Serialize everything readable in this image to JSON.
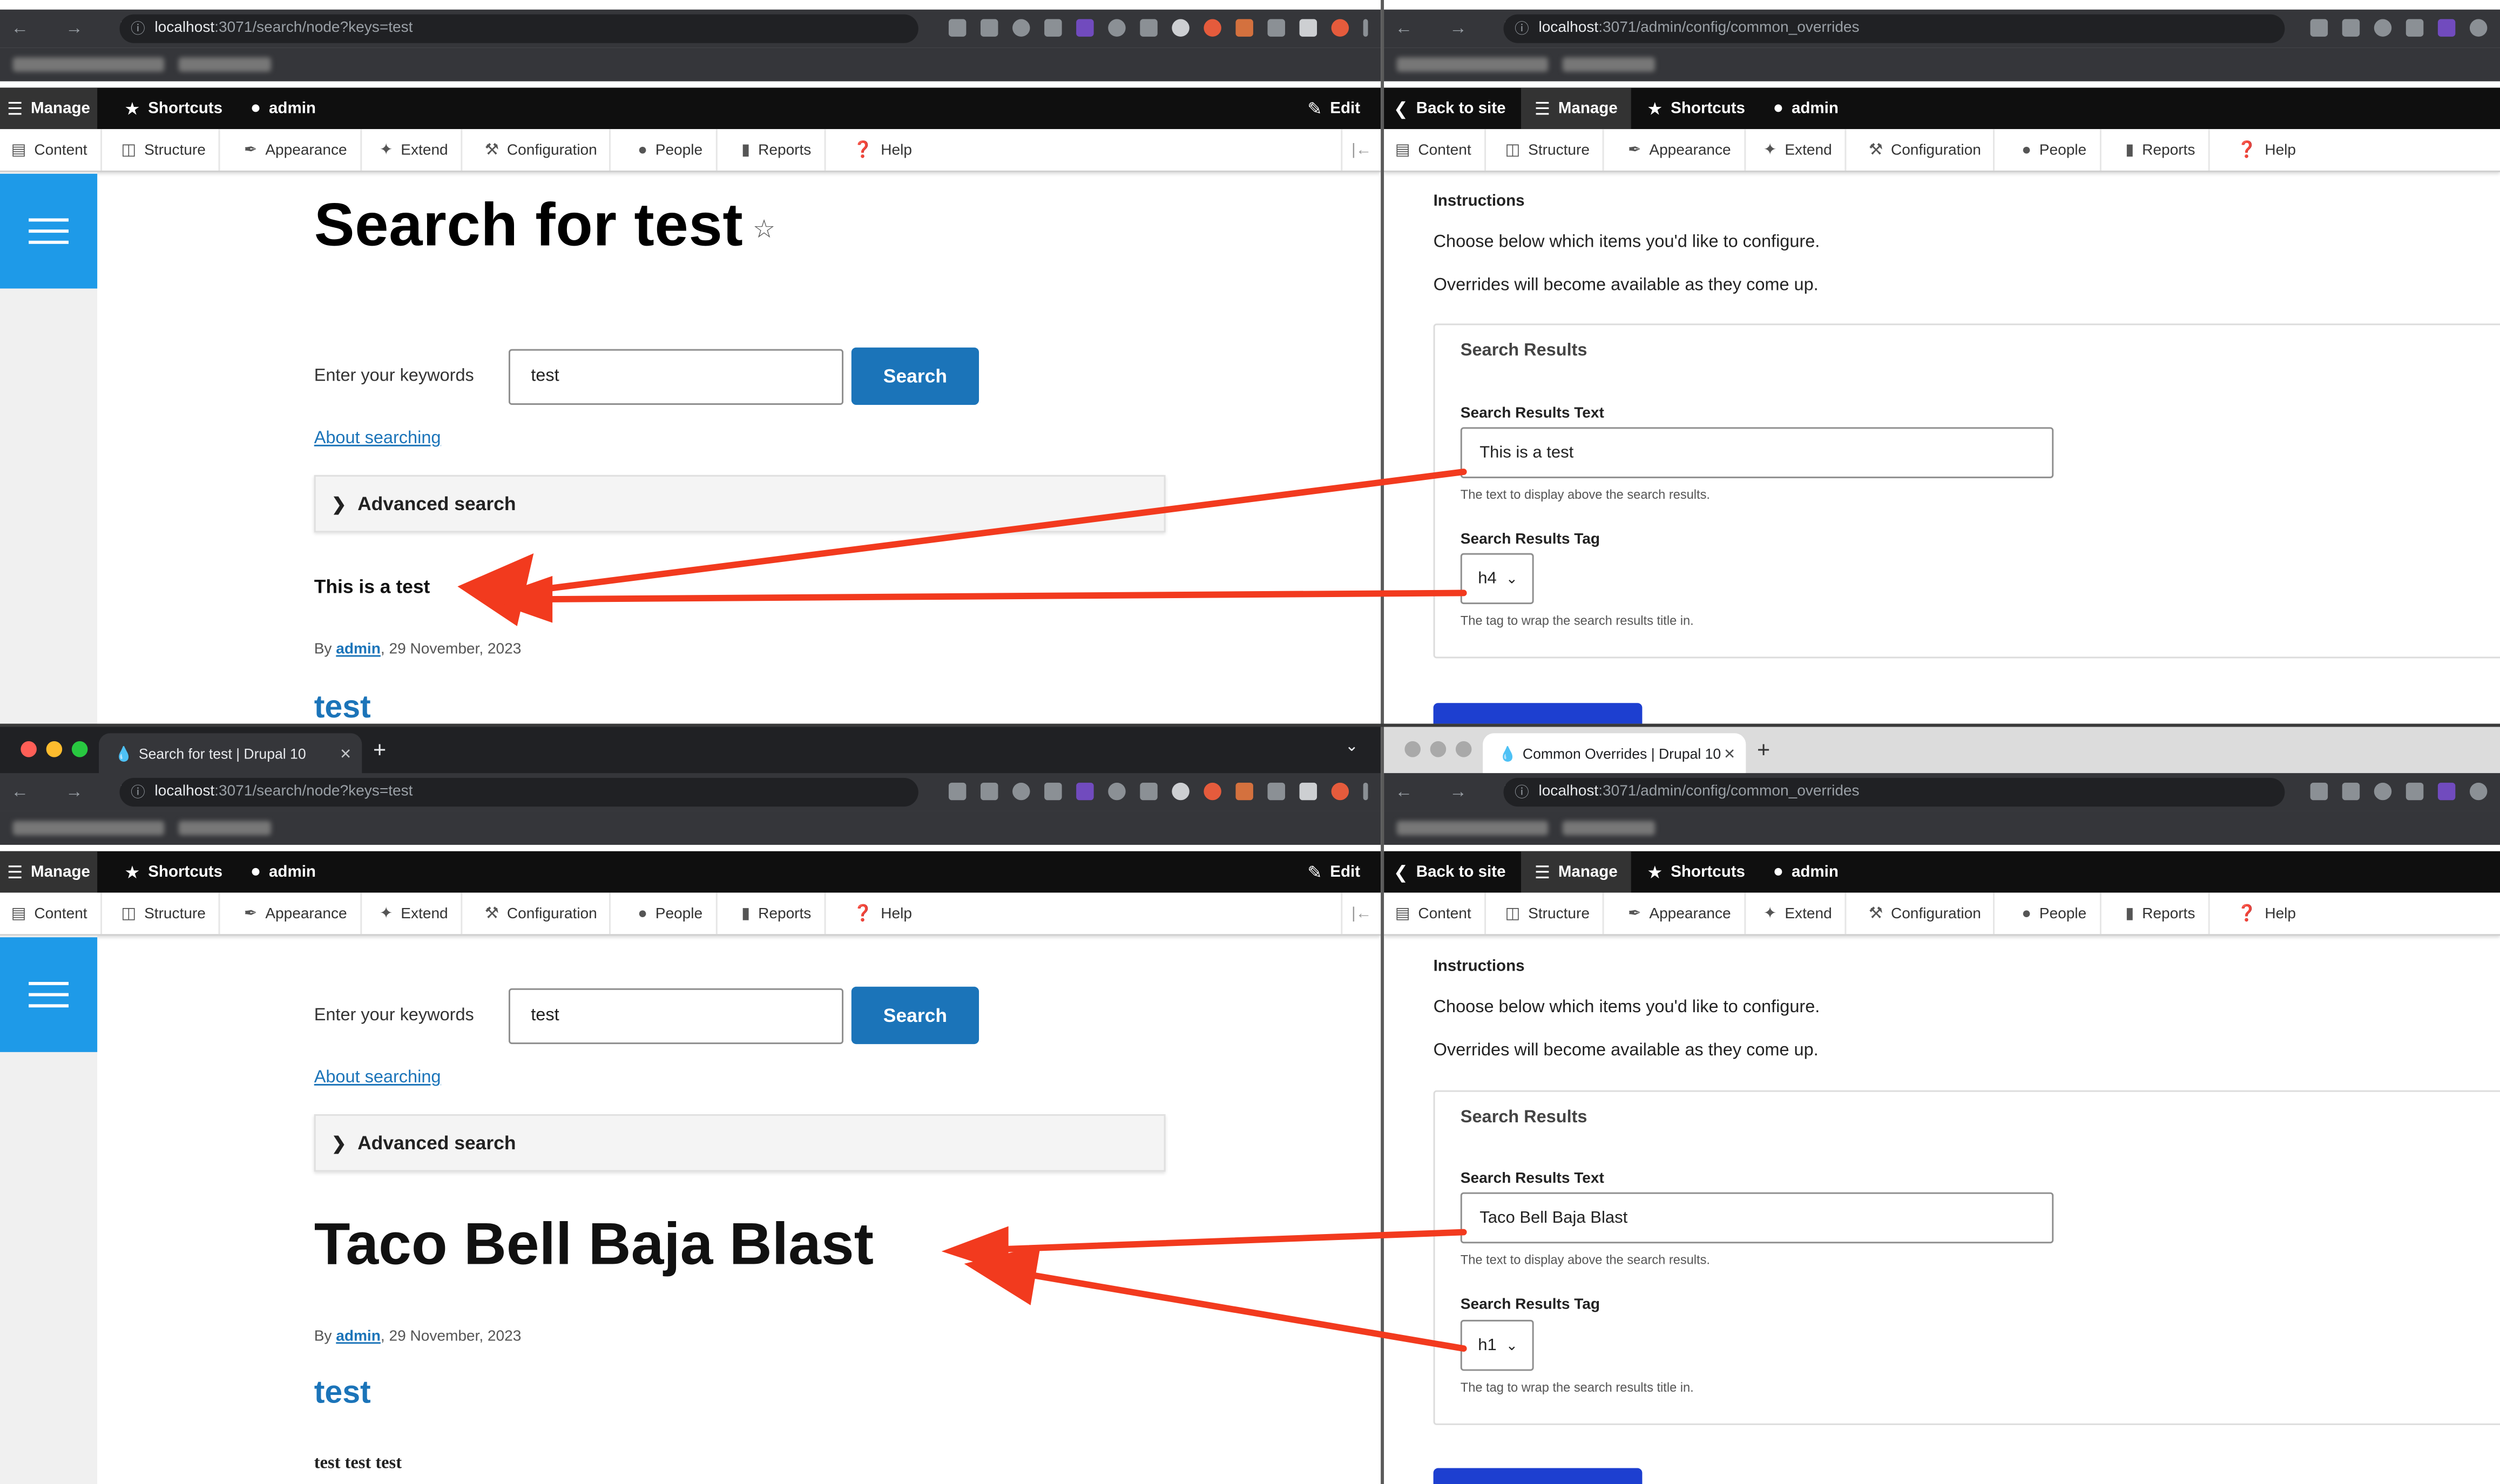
{
  "colors": {
    "accent_blue": "#1b74b9",
    "hamburger_blue": "#1e9ae8",
    "toolbar_dark": "#0f0f0f",
    "arrow_red": "#f23a1e",
    "save_button": "#1d3fd0"
  },
  "browser_left": {
    "tab_title": "Search for test | Drupal 10",
    "url_host": "localhost",
    "url_rest": ":3071/search/node?keys=test"
  },
  "browser_right": {
    "tab_title": "Common Overrides | Drupal 10",
    "url_host": "localhost",
    "url_rest": ":3071/admin/config/common_overrides"
  },
  "toolbar_left": {
    "manage": "Manage",
    "shortcuts": "Shortcuts",
    "user": "admin",
    "edit": "Edit"
  },
  "toolbar_right": {
    "back": "Back to site",
    "manage": "Manage",
    "shortcuts": "Shortcuts",
    "user": "admin"
  },
  "admin_menu": {
    "content": "Content",
    "structure": "Structure",
    "appearance": "Appearance",
    "extend": "Extend",
    "configuration": "Configuration",
    "people": "People",
    "reports": "Reports",
    "help": "Help"
  },
  "search_page_top": {
    "heading": "Search for test",
    "keywords_label": "Enter your keywords",
    "keywords_value": "test",
    "search_button": "Search",
    "about_link": "About searching",
    "advanced": "Advanced search",
    "results_text": "This is a test",
    "byline_prefix": "By ",
    "byline_author": "admin",
    "byline_date": ", 29 November, 2023",
    "result_link": "test"
  },
  "search_page_bottom": {
    "keywords_label": "Enter your keywords",
    "keywords_value": "test",
    "search_button": "Search",
    "about_link": "About searching",
    "advanced": "Advanced search",
    "results_text": "Taco Bell Baja Blast",
    "byline_prefix": "By ",
    "byline_author": "admin",
    "byline_date": ", 29 November, 2023",
    "result_link": "test",
    "snippet": "test test test"
  },
  "overrides_top": {
    "instructions_heading": "Instructions",
    "instructions_line1": "Choose below which items you'd like to configure.",
    "instructions_line2": "Overrides will become available as they come up.",
    "fieldset_legend": "Search Results",
    "text_label": "Search Results Text",
    "text_value": "This is a test",
    "text_desc": "The text to display above the search results.",
    "tag_label": "Search Results Tag",
    "tag_value": "h4",
    "tag_desc": "The tag to wrap the search results title in."
  },
  "overrides_bottom": {
    "instructions_heading": "Instructions",
    "instructions_line1": "Choose below which items you'd like to configure.",
    "instructions_line2": "Overrides will become available as they come up.",
    "fieldset_legend": "Search Results",
    "text_label": "Search Results Text",
    "text_value": "Taco Bell Baja Blast",
    "text_desc": "The text to display above the search results.",
    "tag_label": "Search Results Tag",
    "tag_value": "h1",
    "tag_desc": "The tag to wrap the search results title in."
  }
}
